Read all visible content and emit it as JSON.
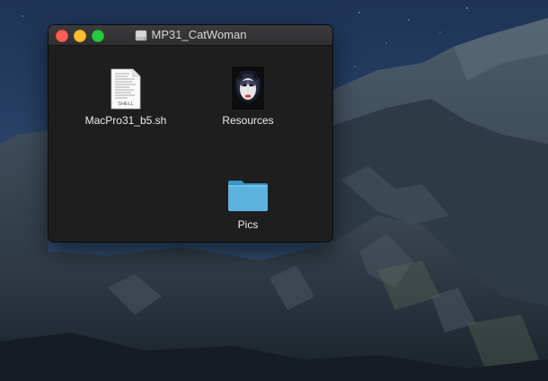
{
  "window": {
    "title": "MP31_CatWoman",
    "title_icon": "drive-icon"
  },
  "files": [
    {
      "name": "MacPro31_b5.sh",
      "kind": "shell-script",
      "icon": "shell-script-icon",
      "icon_badge": "SHELL"
    },
    {
      "name": "Resources",
      "kind": "image-thumbnail",
      "icon": "catwoman-thumbnail-icon"
    },
    {
      "name": "Pics",
      "kind": "folder",
      "icon": "folder-icon"
    }
  ],
  "colors": {
    "window_bg": "#1e1e1e",
    "folder_blue": "#5bb2dd",
    "close": "#fe5f57",
    "minimize": "#febc2e",
    "zoom": "#28c840"
  }
}
